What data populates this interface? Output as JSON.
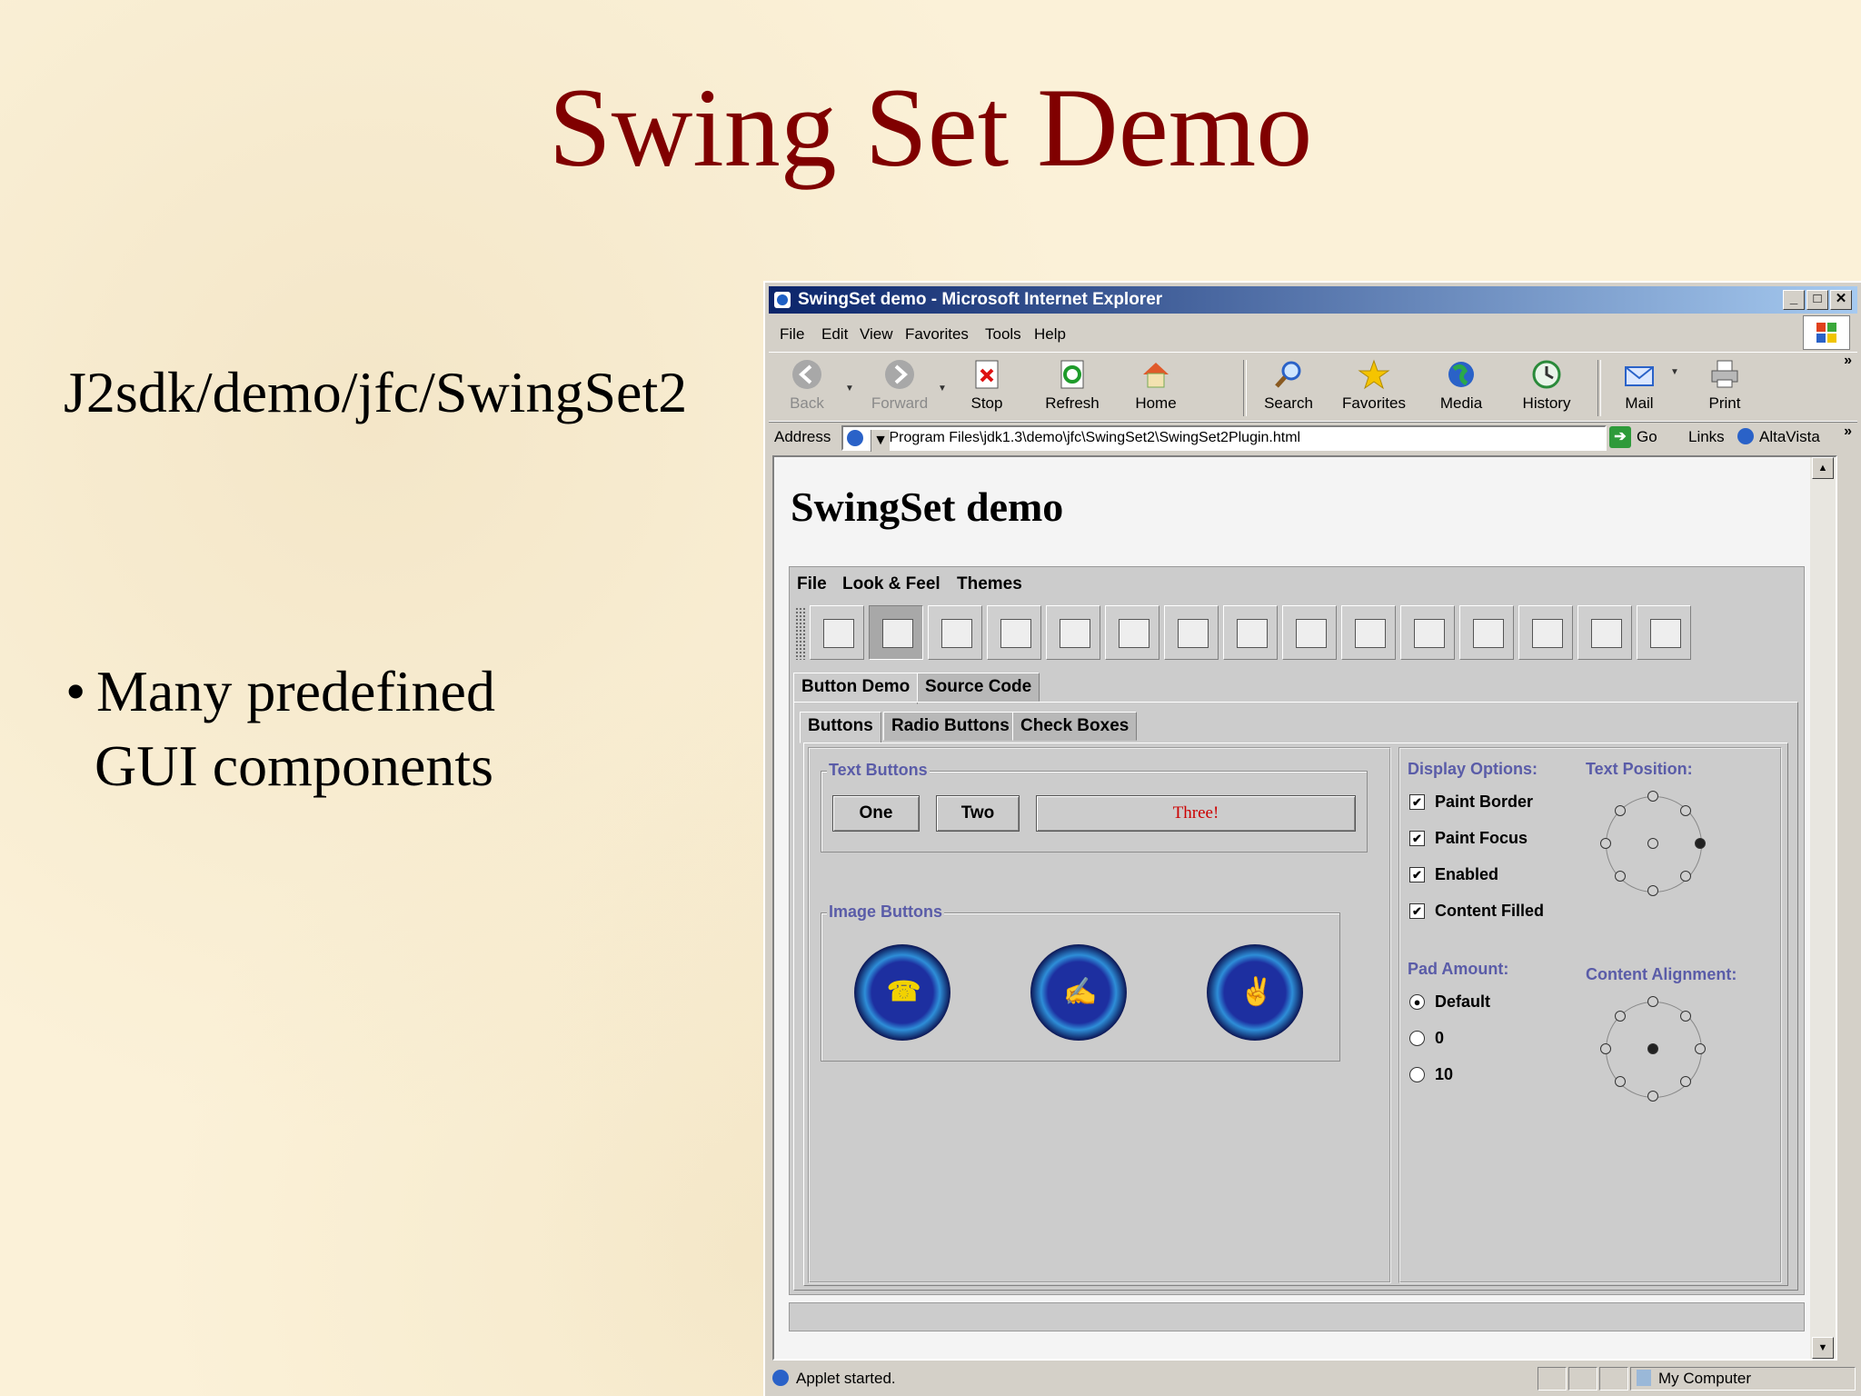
{
  "slide": {
    "title": "Swing Set Demo",
    "path": "J2sdk/demo/jfc/SwingSet2",
    "bullet_line1": "Many predefined",
    "bullet_line2": "GUI components"
  },
  "window": {
    "title": "SwingSet demo - Microsoft Internet Explorer",
    "menu": [
      "File",
      "Edit",
      "View",
      "Favorites",
      "Tools",
      "Help"
    ],
    "toolbar": [
      {
        "label": "Back",
        "icon": "back-arrow-icon",
        "enabled": false
      },
      {
        "label": "Forward",
        "icon": "forward-arrow-icon",
        "enabled": false
      },
      {
        "label": "Stop",
        "icon": "stop-icon",
        "enabled": true
      },
      {
        "label": "Refresh",
        "icon": "refresh-icon",
        "enabled": true
      },
      {
        "label": "Home",
        "icon": "home-icon",
        "enabled": true
      },
      {
        "label": "Search",
        "icon": "search-icon",
        "enabled": true
      },
      {
        "label": "Favorites",
        "icon": "star-icon",
        "enabled": true
      },
      {
        "label": "Media",
        "icon": "globe-icon",
        "enabled": true
      },
      {
        "label": "History",
        "icon": "history-icon",
        "enabled": true
      },
      {
        "label": "Mail",
        "icon": "mail-icon",
        "enabled": true
      },
      {
        "label": "Print",
        "icon": "printer-icon",
        "enabled": true
      }
    ],
    "address_label": "Address",
    "address_value": "C:\\Program Files\\jdk1.3\\demo\\jfc\\SwingSet2\\SwingSet2Plugin.html",
    "go_label": "Go",
    "links_label": "Links",
    "altavista_label": "AltaVista",
    "status_text": "Applet started.",
    "zone_text": "My Computer"
  },
  "page": {
    "heading": "SwingSet demo"
  },
  "applet": {
    "menu": [
      "File",
      "Look & Feel",
      "Themes"
    ],
    "tools": [
      "internal-frame-icon",
      "button-icon",
      "color-chooser-icon",
      "combobox-icon",
      "text-field-icon",
      "list-icon",
      "option-pane-icon",
      "progress-bar-icon",
      "scroll-pane-icon",
      "slider-icon",
      "split-pane-icon",
      "tabbed-pane-icon",
      "table-icon",
      "tooltip-icon",
      "tree-icon"
    ],
    "top_tabs": [
      "Button Demo",
      "Source Code"
    ],
    "sub_tabs": [
      "Buttons",
      "Radio Buttons",
      "Check Boxes"
    ],
    "text_buttons_label": "Text Buttons",
    "text_buttons": [
      "One",
      "Two",
      "Three!"
    ],
    "image_buttons_label": "Image Buttons",
    "image_buttons": [
      "telephone-icon",
      "pen-icon",
      "peace-hand-icon"
    ],
    "display_options_label": "Display Options:",
    "display_options": [
      {
        "label": "Paint Border",
        "checked": true
      },
      {
        "label": "Paint Focus",
        "checked": true
      },
      {
        "label": "Enabled",
        "checked": true
      },
      {
        "label": "Content Filled",
        "checked": true
      }
    ],
    "text_position_label": "Text Position:",
    "pad_amount_label": "Pad Amount:",
    "pad_options": [
      {
        "label": "Default",
        "selected": true
      },
      {
        "label": "0",
        "selected": false
      },
      {
        "label": "10",
        "selected": false
      }
    ],
    "content_alignment_label": "Content Alignment:",
    "colors": {
      "title_red": "#800000",
      "group_label": "#5a5ca8",
      "three_button_text": "#cc0000"
    }
  }
}
